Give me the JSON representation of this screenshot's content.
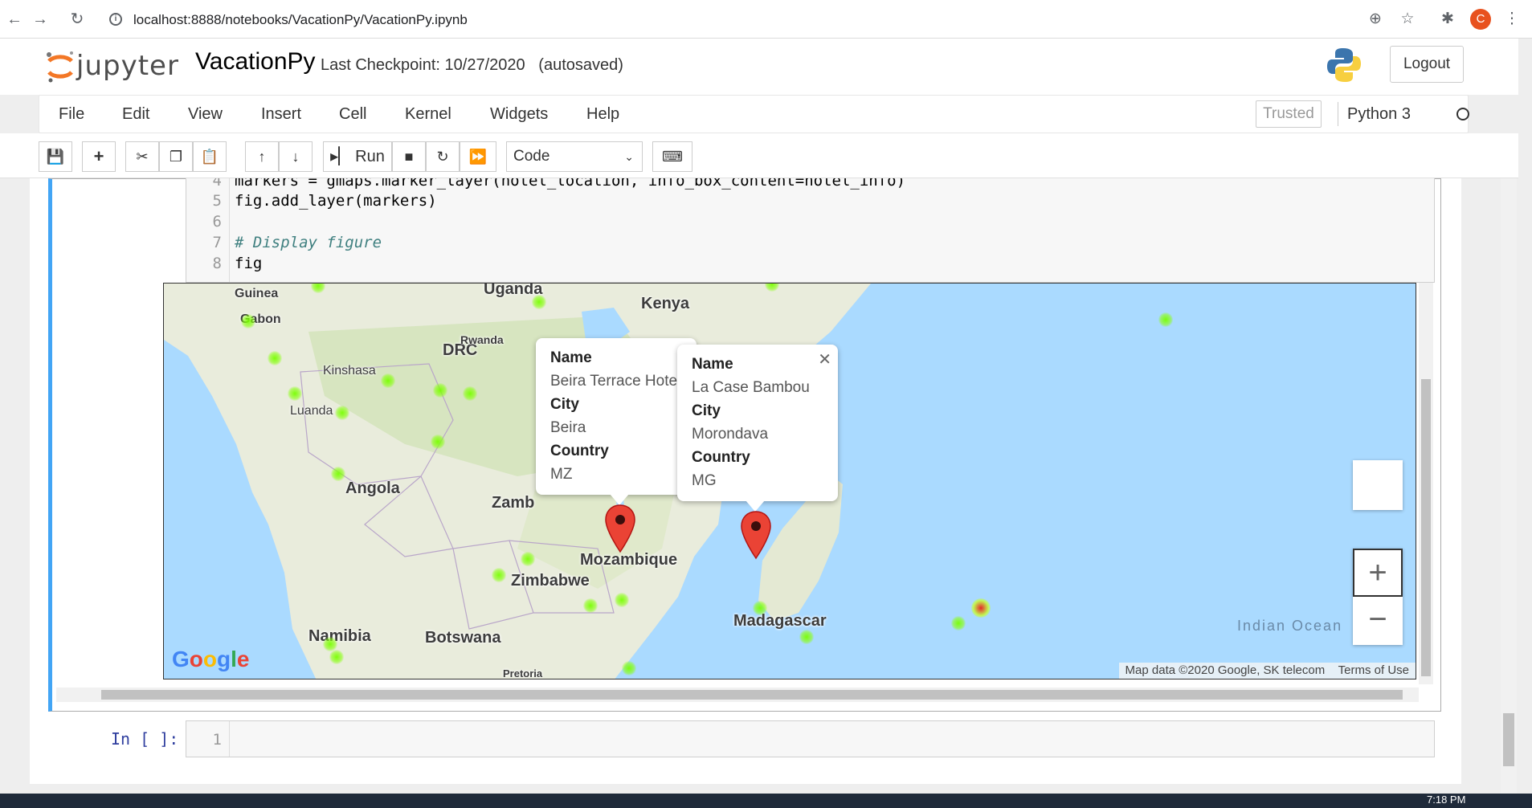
{
  "browser": {
    "url": "localhost:8888/notebooks/VacationPy/VacationPy.ipynb",
    "profile_initial": "C"
  },
  "header": {
    "logo_text": "jupyter",
    "notebook_title": "VacationPy",
    "checkpoint": "Last Checkpoint: 10/27/2020   (autosaved)",
    "logout_label": "Logout"
  },
  "menubar": {
    "items": [
      "File",
      "Edit",
      "View",
      "Insert",
      "Cell",
      "Kernel",
      "Widgets",
      "Help"
    ],
    "trusted": "Trusted",
    "kernel": "Python 3"
  },
  "toolbar": {
    "run_label": "Run",
    "cell_type": "Code"
  },
  "code_cell": {
    "lines": [
      {
        "num": "4",
        "text": "markers = gmaps.marker_layer(hotel_location, info_box_content=hotel_info)"
      },
      {
        "num": "5",
        "text": "fig.add_layer(markers)"
      },
      {
        "num": "6",
        "text": ""
      },
      {
        "num": "7",
        "text": "# Display figure"
      },
      {
        "num": "8",
        "text": "fig"
      }
    ]
  },
  "map": {
    "labels": {
      "guinea": "Guinea",
      "gabon": "Gabon",
      "uganda": "Uganda",
      "kenya": "Kenya",
      "drc": "DRC",
      "rwanda": "Rwanda",
      "kinshasa": "Kinshasa",
      "luanda": "Luanda",
      "angola": "Angola",
      "zambia": "Zamb",
      "mozambique": "Mozambique",
      "zimbabwe": "Zimbabwe",
      "madagascar": "Madagascar",
      "namibia": "Namibia",
      "botswana": "Botswana",
      "pretoria": "Pretoria",
      "indian_ocean": "Indian Ocean"
    },
    "info_left": {
      "name_head": "Name",
      "name": "Beira Terrace Hotel",
      "city_head": "City",
      "city": "Beira",
      "country_head": "Country",
      "country": "MZ"
    },
    "info_right": {
      "name_head": "Name",
      "name": "La Case Bambou",
      "city_head": "City",
      "city": "Morondava",
      "country_head": "Country",
      "country": "MG"
    },
    "attribution": "Map data ©2020 Google, SK telecom",
    "terms": "Terms of Use",
    "google": "Google",
    "zoom_in": "+",
    "zoom_out": "−"
  },
  "empty_cell": {
    "prompt": "In [ ]:",
    "line_num": "1"
  },
  "taskbar": {
    "clock": "7:18 PM"
  }
}
